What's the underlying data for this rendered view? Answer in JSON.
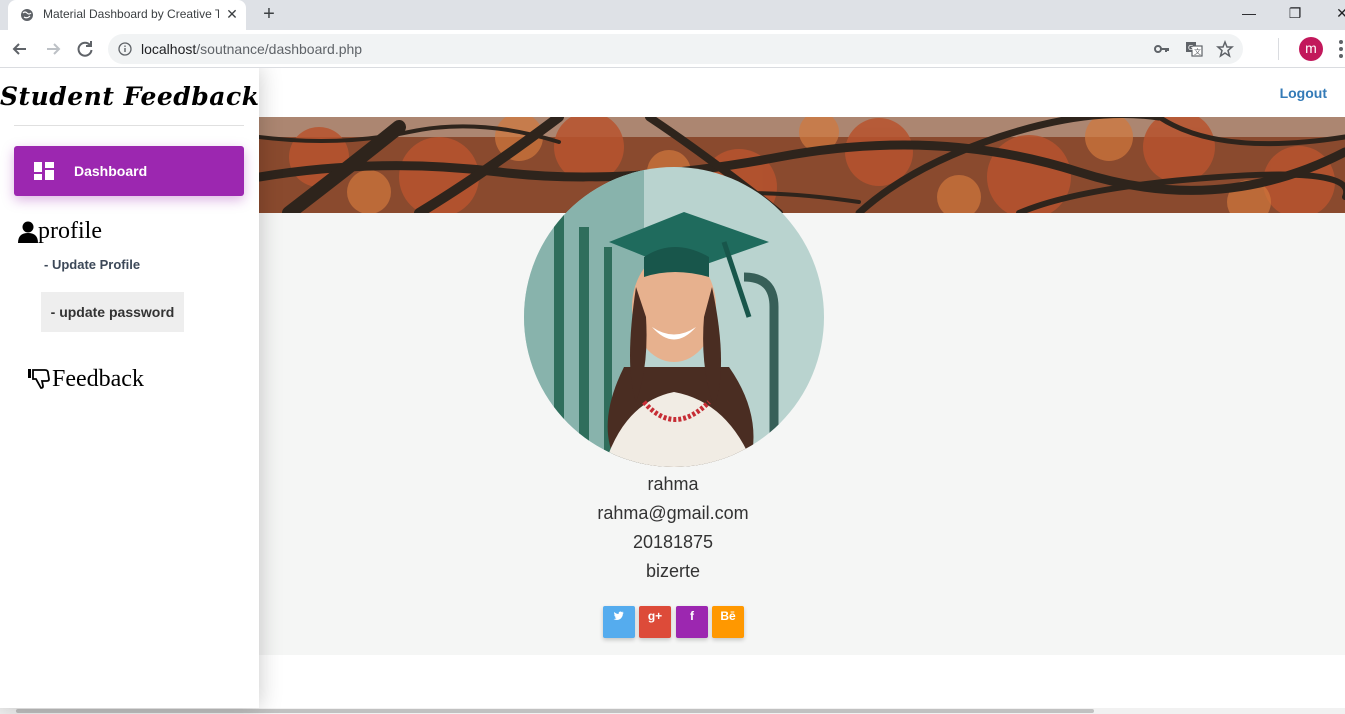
{
  "browser": {
    "tab_title": "Material Dashboard by Creative Tim",
    "url_host": "localhost",
    "url_path": "/soutnance/dashboard.php",
    "profile_initial": "m"
  },
  "sidebar": {
    "brand": "Student Feedback",
    "items": [
      {
        "label": "Dashboard",
        "icon": "dashboard-icon",
        "active": true
      },
      {
        "label": "profile",
        "icon": "user-icon"
      },
      {
        "label": "- Update Profile"
      },
      {
        "label": "- update password"
      },
      {
        "label": "Feedback",
        "icon": "thumbs-down-icon"
      }
    ]
  },
  "topnav": {
    "logout_label": "Logout"
  },
  "profile": {
    "name": "rahma",
    "email": "rahma@gmail.com",
    "id_number": "20181875",
    "city": "bizerte"
  },
  "social": [
    {
      "label": "twitter",
      "glyph": "🐦",
      "color": "#55acee"
    },
    {
      "label": "google-plus",
      "glyph": "g+",
      "color": "#dd4b39"
    },
    {
      "label": "facebook",
      "glyph": "f",
      "color": "#9c27b0"
    },
    {
      "label": "behance",
      "glyph": "Bē",
      "color": "#ff9800"
    }
  ],
  "colors": {
    "accent": "#9c27b0",
    "link": "#337ab7"
  }
}
